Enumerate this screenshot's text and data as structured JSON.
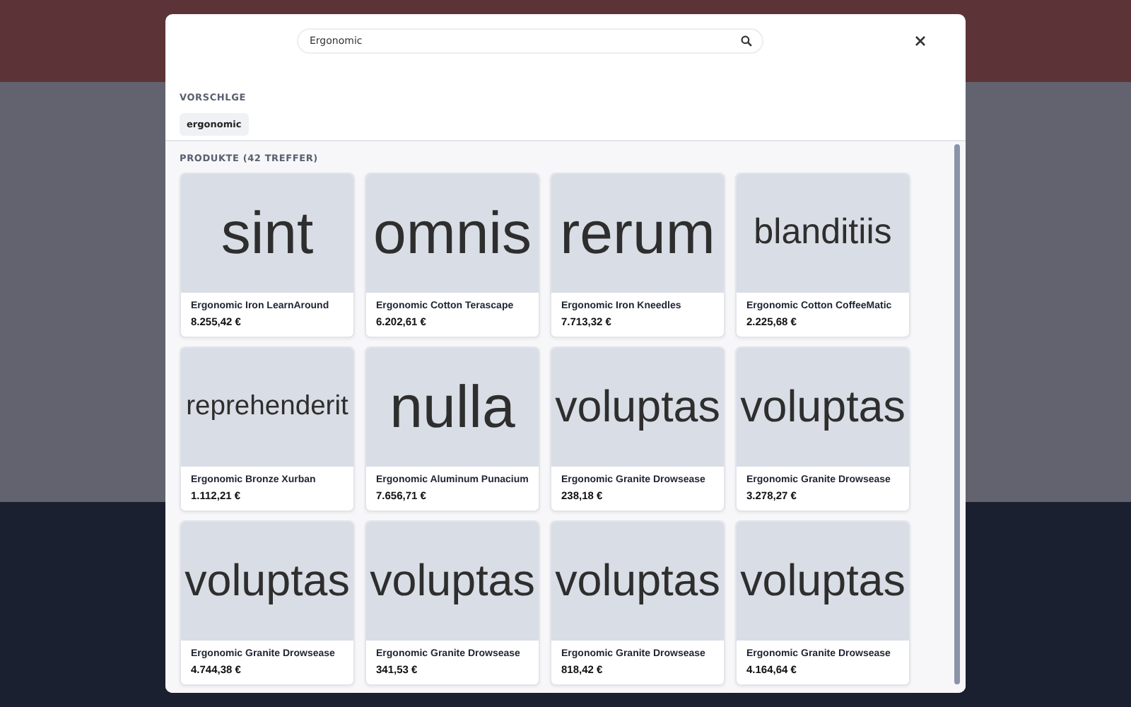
{
  "search": {
    "value": "Ergonomic"
  },
  "suggestions": {
    "title": "VORSCHLGE",
    "items": [
      "ergonomic"
    ]
  },
  "products": {
    "title": "PRODUKTE (42 TREFFER)",
    "items": [
      {
        "image_text": "sint",
        "name": "Ergonomic Iron LearnAround",
        "price": "8.255,42 €"
      },
      {
        "image_text": "omnis",
        "name": "Ergonomic Cotton Terascape",
        "price": "6.202,61 €"
      },
      {
        "image_text": "rerum",
        "name": "Ergonomic Iron Kneedles",
        "price": "7.713,32 €"
      },
      {
        "image_text": "blanditiis",
        "name": "Ergonomic Cotton CoffeeMatic",
        "price": "2.225,68 €"
      },
      {
        "image_text": "reprehenderit",
        "name": "Ergonomic Bronze Xurban",
        "price": "1.112,21 €"
      },
      {
        "image_text": "nulla",
        "name": "Ergonomic Aluminum Punacium",
        "price": "7.656,71 €"
      },
      {
        "image_text": "voluptas",
        "name": "Ergonomic Granite Drowsease",
        "price": "238,18 €"
      },
      {
        "image_text": "voluptas",
        "name": "Ergonomic Granite Drowsease",
        "price": "3.278,27 €"
      },
      {
        "image_text": "voluptas",
        "name": "Ergonomic Granite Drowsease",
        "price": "4.744,38 €"
      },
      {
        "image_text": "voluptas",
        "name": "Ergonomic Granite Drowsease",
        "price": "341,53 €"
      },
      {
        "image_text": "voluptas",
        "name": "Ergonomic Granite Drowsease",
        "price": "818,42 €"
      },
      {
        "image_text": "voluptas",
        "name": "Ergonomic Granite Drowsease",
        "price": "4.164,64 €"
      }
    ]
  }
}
